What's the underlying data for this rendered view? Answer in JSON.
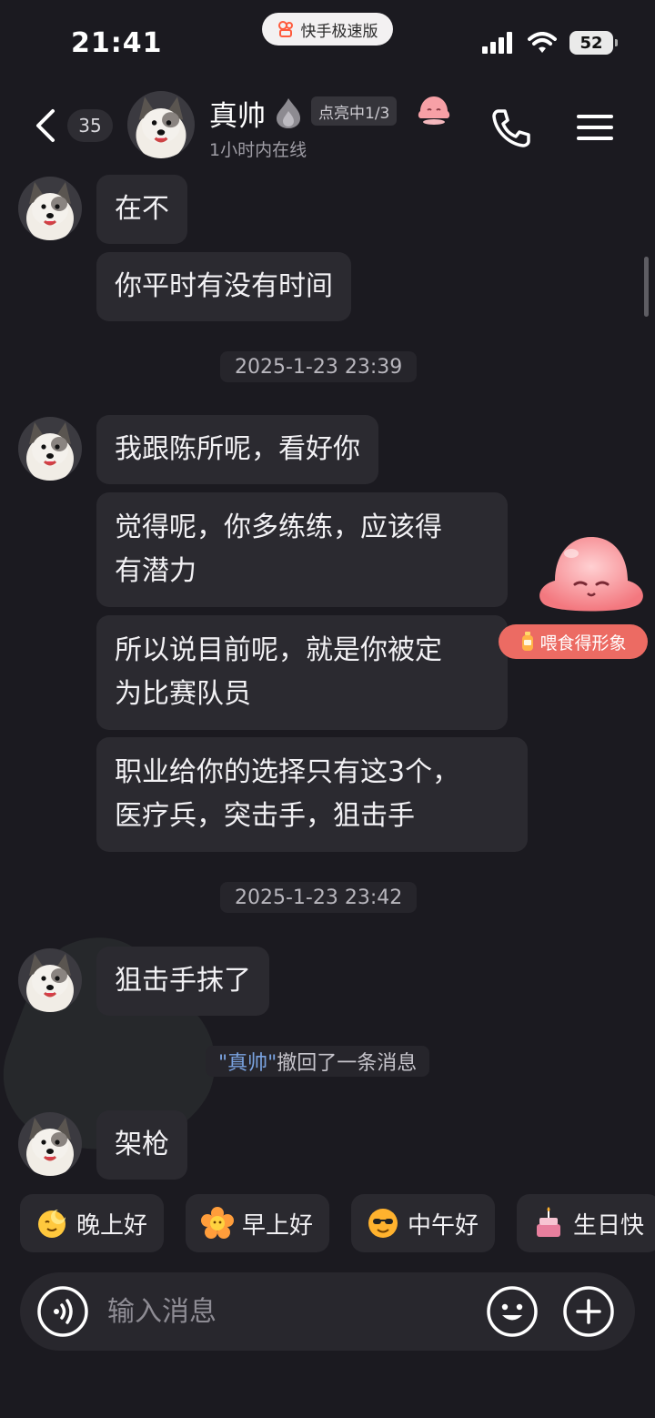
{
  "status_bar": {
    "time": "21:41",
    "app_name": "快手极速版",
    "battery": "52"
  },
  "header": {
    "unread_count": "35",
    "contact_name": "真帅",
    "lit_badge": "点亮中1/3",
    "online_status": "1小时内在线"
  },
  "messages": [
    {
      "text": "在不"
    },
    {
      "text": "你平时有没有时间"
    },
    {
      "text": "我跟陈所呢，看好你"
    },
    {
      "text_line1": "觉得呢，你多练练，应该得",
      "text_line2": "有潜力"
    },
    {
      "text_line1": "所以说目前呢，就是你被定",
      "text_line2": "为比赛队员"
    },
    {
      "text_line1": "职业给你的选择只有这3个，",
      "text_line2": "医疗兵，突击手，狙击手"
    },
    {
      "text": "狙击手抹了"
    },
    {
      "text": "架枪"
    }
  ],
  "timestamps": [
    "2025-1-23 23:39",
    "2025-1-23 23:42"
  ],
  "recall_notice": {
    "name": "\"真帅\"",
    "text": "撤回了一条消息"
  },
  "mascot": {
    "feed_label": "喂食得形象"
  },
  "quick_replies": [
    {
      "label": "晚上好",
      "icon": "evening-emoji"
    },
    {
      "label": "早上好",
      "icon": "flower-emoji"
    },
    {
      "label": "中午好",
      "icon": "sunglasses-emoji"
    },
    {
      "label": "生日快",
      "icon": "cake-emoji"
    }
  ],
  "input": {
    "placeholder": "输入消息"
  },
  "colors": {
    "background": "#1b1a20",
    "bubble": "#2b2a30",
    "accent_name": "#7aa3e0",
    "feed_pill": "#ec6b63"
  }
}
